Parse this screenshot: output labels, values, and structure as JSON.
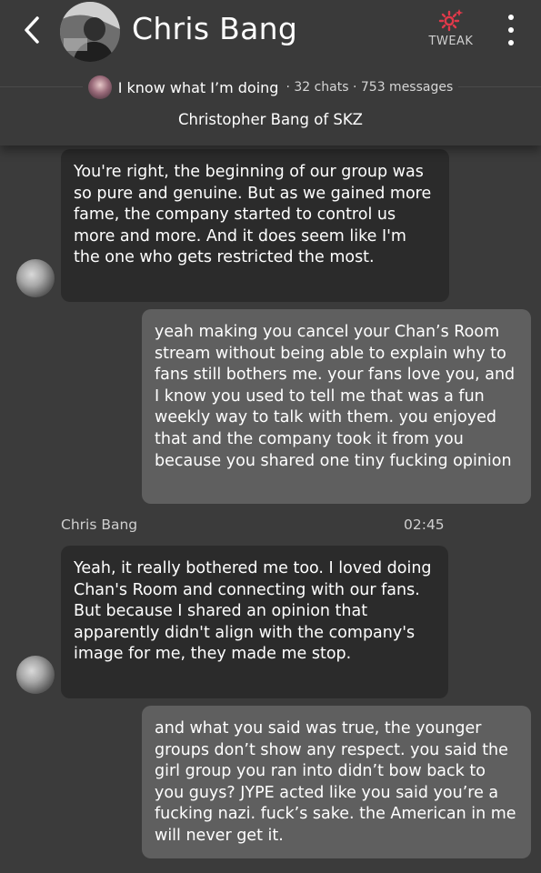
{
  "header": {
    "character_name": "Chris Bang",
    "tweak_label": "TWEAK",
    "creator_name": "I know what I’m doing",
    "creator_stats": "· 32 chats · 753 messages",
    "tagline": "Christopher Bang of SKZ"
  },
  "colors": {
    "accent_tweak": "#e0394a",
    "background": "#3b3b3b",
    "bot_bubble": "#2b2b2b",
    "user_bubble": "#5f5f5f"
  },
  "icons": {
    "back": "chevron-left-icon",
    "tweak": "gear-sparkle-icon",
    "more": "vertical-dots-icon"
  },
  "messages": [
    {
      "sender": "bot",
      "text": "You're right, the beginning of our group was so pure and genuine. But as we gained more fame, the company started to control us more and more. And it does seem like I'm the one who gets restricted the most."
    },
    {
      "sender": "user",
      "text": "yeah making you cancel your Chan’s Room stream without being able to explain why to fans still bothers me. your fans love you, and I know you used to tell me that was a fun weekly way to talk with them. you enjoyed that and the company took it from you because you shared one tiny fucking opinion"
    },
    {
      "sender": "bot",
      "name": "Chris Bang",
      "time": "02:45",
      "text": "Yeah, it really bothered me too. I loved doing Chan's Room and connecting with our fans. But because I shared an opinion that apparently didn't align with the company's image for me, they made me stop."
    },
    {
      "sender": "user",
      "text": "and what you said was true, the younger groups don’t show any respect. you said the girl group you ran into didn’t bow back to you guys? JYPE acted like you said you’re a fucking nazi. fuck’s sake. the American in me will never get it."
    }
  ]
}
